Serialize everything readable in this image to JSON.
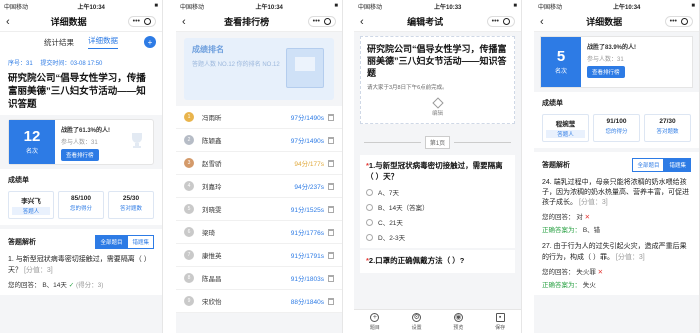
{
  "status": {
    "carrier": "中国移动",
    "time1": "上午10:34",
    "time2": "上午10:34",
    "time3": "上午10:33",
    "time4": "上午10:34",
    "battery": "■"
  },
  "p1": {
    "nav_title": "详细数据",
    "tabs": [
      "统计结果",
      "详细数据"
    ],
    "plus": "+",
    "meta": {
      "seq": "序号：31",
      "submit": "提交时间：03-08 17:50"
    },
    "title": "研究院公司“倡导女性学习，传播富丽美德”三八妇女节活动——知识答题",
    "rank": {
      "num": "12",
      "label": "名次",
      "beat": "战胜了61.3%的人!",
      "count": "参与人数：31",
      "btn": "查看排行榜"
    },
    "scorecard": {
      "title": "成绩单",
      "name": "李兴飞",
      "name_sub": "答题人",
      "score": "85/100",
      "score_sub": "您的得分",
      "correct": "25/30",
      "correct_sub": "答对题数"
    },
    "analysis": {
      "title": "答题解析",
      "toggle_all": "全部题目",
      "toggle_wrong": "错题集",
      "q": "1. 与新型冠状病毒密切接触过，需要隔离（ ）天？",
      "q_score": "[分值：3]",
      "ans_label": "您的回答：",
      "ans": "B、14天",
      "ans_score": "(得分：3)"
    }
  },
  "p2": {
    "nav_title": "查看排行榜",
    "banner_title": "成绩排名",
    "banner_sub": "答题人数 NO.12 你的排名 NO.12",
    "rows": [
      {
        "rank": "1",
        "name": "冯雨昕",
        "score": "97分/1490s",
        "medal": "g"
      },
      {
        "rank": "2",
        "name": "陈颖鑫",
        "score": "97分/1490s",
        "medal": "s"
      },
      {
        "rank": "3",
        "name": "赵雪骄",
        "score": "94分/177s",
        "medal": "b"
      },
      {
        "rank": "4",
        "name": "刘嘉玲",
        "score": "94分/237s",
        "medal": ""
      },
      {
        "rank": "5",
        "name": "刘晓雯",
        "score": "91分/1525s",
        "medal": ""
      },
      {
        "rank": "6",
        "name": "梁琦",
        "score": "91分/1776s",
        "medal": ""
      },
      {
        "rank": "7",
        "name": "康惟英",
        "score": "91分/1791s",
        "medal": ""
      },
      {
        "rank": "8",
        "name": "陈晶昌",
        "score": "91分/1803s",
        "medal": ""
      },
      {
        "rank": "9",
        "name": "宋欣怡",
        "score": "88分/1840s",
        "medal": ""
      }
    ]
  },
  "p3": {
    "nav_title": "编辑考试",
    "title": "研究院公司“倡导女性学习，传播富丽美德”三八妇女节活动——知识答题",
    "sub": "请大家于3月8日下午6点前完成。",
    "edit": "编辑",
    "page": "第1页",
    "q1": "1.与新型冠状病毒密切接触过，需要隔离（ ）天？",
    "options": [
      "A、7天",
      "B、14天（答案）",
      "C、21天",
      "D、2-3天"
    ],
    "q2": "2.口罩的正确佩戴方法（ ）?",
    "tools": [
      "题目",
      "设置",
      "预览",
      "保存"
    ]
  },
  "p4": {
    "rank": {
      "num": "5",
      "label": "名次",
      "beat": "战胜了83.9%的人!",
      "count": "参与人数：31",
      "btn": "查看排行榜"
    },
    "scorecard": {
      "title": "成绩单",
      "name": "程婉莹",
      "name_sub": "答题人",
      "score": "91/100",
      "score_sub": "您的得分",
      "correct": "27/30",
      "correct_sub": "答对题数"
    },
    "analysis": {
      "title": "答题解析",
      "toggle_all": "全部题目",
      "toggle_wrong": "错题集",
      "q24": "24. 端乳过程中，母亲只能将浓稠的奶水喂给孩子，因为浓稠的奶水热量高、营养丰富，可促进孩子成长。",
      "q24_score": "[分值：3]",
      "q24_ans_label": "您的回答：",
      "q24_ans": "对",
      "q24_correct_label": "正确答案为：",
      "q24_correct": "B、错",
      "q27": "27. 由于行为人的过失引起火灾，造成严重后果的行为，构成（ ）罪。",
      "q27_score": "[分值：3]",
      "q27_ans_label": "您的回答：",
      "q27_ans": "失火罪",
      "q27_correct_label": "正确答案为：",
      "q27_correct": "失火"
    }
  }
}
